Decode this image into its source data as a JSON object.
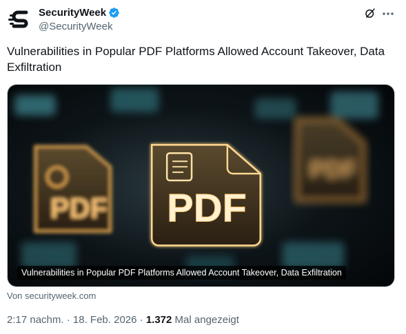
{
  "author": {
    "display_name": "SecurityWeek",
    "handle": "@SecurityWeek",
    "verified": true,
    "avatar_icon": "securityweek-s-logo"
  },
  "actions": {
    "grok_icon": "grok-icon",
    "more_icon": "more-horizontal-icon"
  },
  "tweet": {
    "text": "Vulnerabilities in Popular PDF Platforms Allowed Account Takeover, Data Exfiltration"
  },
  "card": {
    "image_text": "PDF",
    "caption": "Vulnerabilities in Popular PDF Platforms Allowed Account Takeover, Data Exfiltration",
    "source": "Von securityweek.com"
  },
  "meta": {
    "time": "2:17 nachm.",
    "separator": "·",
    "date": "18. Feb. 2026",
    "views_count": "1.372",
    "views_label": "Mal angezeigt"
  },
  "colors": {
    "text_primary": "#0f1419",
    "text_secondary": "#536471",
    "verified_blue": "#1d9bf0"
  }
}
